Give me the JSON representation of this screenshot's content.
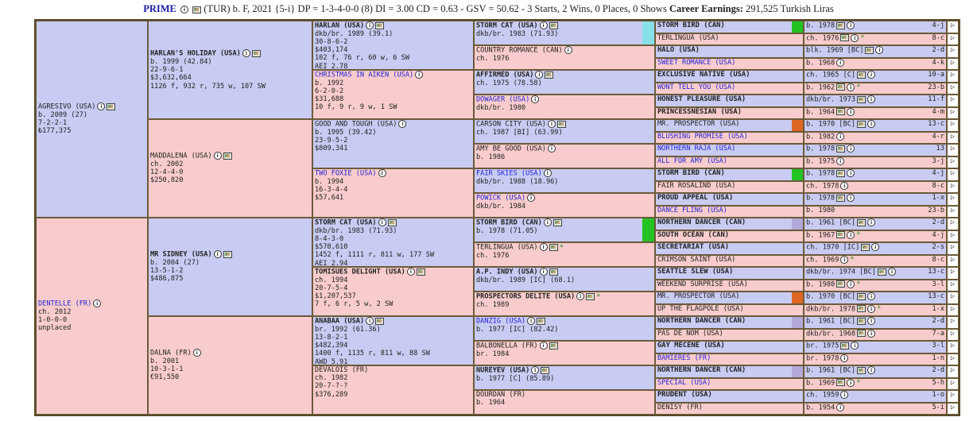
{
  "header": {
    "name": "PRIME",
    "desc1": "(TUR) b. F, 2021 {5-i} DP = 1-3-4-0-0 (8) DI = 3.00  CD = 0.63 - GSV = 50.62 - 3 Starts, 2 Wins, 0 Places, 0 Shows",
    "earnings_label": "Career Earnings:",
    "earnings_value": "291,525 Turkish Liras"
  },
  "colors": {
    "male": "#c8cbf2",
    "female": "#f8cccc",
    "border": "#5a4a2a",
    "link": "#2525d6",
    "green": "#22c322",
    "orange": "#dd6622",
    "cyan": "#88e0e8",
    "lavender": "#b3a8d8"
  },
  "g1": [
    {
      "name": "AGRESIVO (USA)",
      "lines": [
        "b. 2009 (27)",
        "7-2-2-1",
        "₺177,375"
      ],
      "icons": [
        "info",
        "photo"
      ],
      "sex": "m",
      "link": false
    },
    {
      "name": "DENTELLE (FR)",
      "lines": [
        "ch. 2012",
        "1-0-0-0",
        "unplaced"
      ],
      "icons": [
        "info"
      ],
      "sex": "f",
      "link": true
    }
  ],
  "g2": [
    {
      "name": "HARLAN'S HOLIDAY (USA)",
      "lines": [
        "b. 1999 (42.84)",
        "22-9-6-1",
        "$3,632,664",
        "1126 f, 932 r, 735 w, 107 SW"
      ],
      "icons": [
        "info",
        "photo"
      ],
      "sex": "m",
      "bold": true
    },
    {
      "name": "MADDALENA (USA)",
      "lines": [
        "ch. 2002",
        "12-4-4-0",
        "$250,820"
      ],
      "icons": [
        "info",
        "photo"
      ],
      "sex": "f"
    },
    {
      "name": "MR SIDNEY (USA)",
      "lines": [
        "b. 2004 (27)",
        "13-5-1-2",
        "$486,875"
      ],
      "icons": [
        "info",
        "photo"
      ],
      "sex": "m",
      "bold": true
    },
    {
      "name": "DALNA (FR)",
      "lines": [
        "b. 2001",
        "10-3-1-1",
        "€91,550"
      ],
      "icons": [
        "info"
      ],
      "sex": "f"
    }
  ],
  "g3": [
    {
      "name": "HARLAN (USA)",
      "lines": [
        "dkb/br. 1989 (39.1)",
        "30-8-6-2",
        "$403,174",
        "102 f, 76 r, 60 w, 6 SW",
        "AEI 2.78"
      ],
      "icons": [
        "info",
        "photo"
      ],
      "sex": "m",
      "bold": true
    },
    {
      "name": "CHRISTMAS IN AIKEN (USA)",
      "lines": [
        "b. 1992",
        "6-2-0-2",
        "$31,688",
        "10 f, 9 r, 9 w, 1 SW"
      ],
      "icons": [
        "info"
      ],
      "sex": "f",
      "link": true
    },
    {
      "name": "GOOD AND TOUGH (USA)",
      "lines": [
        "b. 1995 (39.42)",
        "23-9-5-2",
        "$809,341"
      ],
      "icons": [
        "info"
      ],
      "sex": "m"
    },
    {
      "name": "TWO FOXIE (USA)",
      "lines": [
        "b. 1994",
        "16-3-4-4",
        "$57,641"
      ],
      "icons": [
        "info"
      ],
      "sex": "f",
      "link": true
    },
    {
      "name": "STORM CAT (USA)",
      "lines": [
        "dkb/br. 1983 (71.93)",
        "8-4-3-0",
        "$570,610",
        "1452 f, 1111 r, 811 w, 177 SW",
        "AEI 2.94"
      ],
      "icons": [
        "info",
        "photo"
      ],
      "sex": "m",
      "bold": true
    },
    {
      "name": "TOMISUES DELIGHT (USA)",
      "lines": [
        "ch. 1994",
        "20-7-5-4",
        "$1,207,537",
        "7 f, 6 r, 5 w, 2 SW"
      ],
      "icons": [
        "info",
        "photo"
      ],
      "sex": "f",
      "bold": true
    },
    {
      "name": "ANABAA (USA)",
      "lines": [
        "br. 1992 (61.36)",
        "13-8-2-1",
        "$482,394",
        "1400 f, 1135 r, 811 w, 88 SW",
        "AWD 5.91"
      ],
      "icons": [
        "info",
        "photo"
      ],
      "sex": "m",
      "bold": true
    },
    {
      "name": "DEVALOIS (FR)",
      "lines": [
        "ch. 1982",
        "20-7-?-?",
        "$376,289"
      ],
      "icons": [],
      "sex": "f"
    }
  ],
  "g4": [
    {
      "name": "STORM CAT (USA)",
      "lines": [
        "dkb/br. 1983 (71.93)"
      ],
      "icons": [
        "info",
        "photo"
      ],
      "sex": "m",
      "bold": true,
      "bar": "cyan"
    },
    {
      "name": "COUNTRY ROMANCE (CAN)",
      "lines": [
        "ch. 1976"
      ],
      "icons": [
        "info"
      ],
      "sex": "f"
    },
    {
      "name": "AFFIRMED (USA)",
      "lines": [
        "ch. 1975 (78.58)"
      ],
      "icons": [
        "info",
        "photo"
      ],
      "sex": "m",
      "bold": true
    },
    {
      "name": "DOWAGER (USA)",
      "lines": [
        "dkb/br. 1980"
      ],
      "icons": [
        "info"
      ],
      "sex": "f",
      "link": true
    },
    {
      "name": "CARSON CITY (USA)",
      "lines": [
        "ch. 1987 [BI] (63.99)"
      ],
      "icons": [
        "info",
        "photo"
      ],
      "sex": "m"
    },
    {
      "name": "AMY BE GOOD (USA)",
      "lines": [
        "b. 1986"
      ],
      "icons": [
        "info"
      ],
      "sex": "f"
    },
    {
      "name": "FAIR SKIES (USA)",
      "lines": [
        "dkb/br. 1988 (18.96)"
      ],
      "icons": [
        "info"
      ],
      "sex": "m",
      "link": true
    },
    {
      "name": "POWICK (USA)",
      "lines": [
        "dkb/br. 1984"
      ],
      "icons": [
        "info"
      ],
      "sex": "f",
      "link": true
    },
    {
      "name": "STORM BIRD (CAN)",
      "lines": [
        "b. 1978 (71.05)"
      ],
      "icons": [
        "info",
        "photo"
      ],
      "sex": "m",
      "bold": true,
      "bar": "green"
    },
    {
      "name": "TERLINGUA (USA)",
      "lines": [
        "ch. 1976"
      ],
      "icons": [
        "info",
        "photo"
      ],
      "star": true,
      "sex": "f"
    },
    {
      "name": "A.P. INDY (USA)",
      "lines": [
        "dkb/br. 1989 [IC] (68.1)"
      ],
      "icons": [
        "info",
        "photo"
      ],
      "sex": "m",
      "bold": true
    },
    {
      "name": "PROSPECTORS DELITE (USA)",
      "lines": [
        "ch. 1989"
      ],
      "icons": [
        "info",
        "photo"
      ],
      "star": true,
      "sex": "f",
      "bold": true
    },
    {
      "name": "DANZIG (USA)",
      "lines": [
        "b. 1977 [IC] (82.42)"
      ],
      "icons": [
        "info",
        "photo"
      ],
      "sex": "m",
      "link": true
    },
    {
      "name": "BALBONELLA (FR)",
      "lines": [
        "br. 1984"
      ],
      "icons": [
        "info",
        "photo"
      ],
      "sex": "f"
    },
    {
      "name": "NUREYEV (USA)",
      "lines": [
        "b. 1977 [C] (85.89)"
      ],
      "icons": [
        "info",
        "photo"
      ],
      "sex": "m",
      "bold": true
    },
    {
      "name": "DOURDAN (FR)",
      "lines": [
        "b. 1964"
      ],
      "icons": [],
      "sex": "f"
    }
  ],
  "g5": [
    {
      "name": "STORM BIRD (CAN)",
      "sex": "m",
      "bold": true,
      "desc": "b. 1978",
      "icons": [
        "photo",
        "info"
      ],
      "dp": "4-j",
      "bar": "green"
    },
    {
      "name": "TERLINGUA (USA)",
      "sex": "f",
      "desc": "ch. 1976",
      "icons": [
        "photo",
        "info"
      ],
      "star": true,
      "dp": "8-c"
    },
    {
      "name": "HALO (USA)",
      "sex": "m",
      "bold": true,
      "desc": "blk. 1969 [BC]",
      "icons": [
        "photo",
        "info"
      ],
      "dp": "2-d",
      "big": true
    },
    {
      "name": "SWEET ROMANCE (USA)",
      "sex": "f",
      "link": true,
      "desc": "b. 1968",
      "icons": [
        "info"
      ],
      "dp": "4-k"
    },
    {
      "name": "EXCLUSIVE NATIVE (USA)",
      "sex": "m",
      "bold": true,
      "desc": "ch. 1965 [C]",
      "icons": [
        "photo",
        "info"
      ],
      "dp": "10-a"
    },
    {
      "name": "WONT TELL YOU (USA)",
      "sex": "f",
      "link": true,
      "desc": "b. 1962",
      "icons": [
        "photo",
        "info"
      ],
      "star": true,
      "dp": "23-b"
    },
    {
      "name": "HONEST PLEASURE (USA)",
      "sex": "m",
      "bold": true,
      "desc": "dkb/br. 1973",
      "icons": [
        "photo",
        "info"
      ],
      "dp": "11-f"
    },
    {
      "name": "PRINCESSNESIAN (USA)",
      "sex": "f",
      "bold": true,
      "desc": "b. 1964",
      "icons": [
        "photo",
        "info"
      ],
      "dp": "4-m"
    },
    {
      "name": "MR. PROSPECTOR (USA)",
      "sex": "m",
      "desc": "b. 1970 [BC]",
      "icons": [
        "photo",
        "info"
      ],
      "dp": "13-c",
      "bar": "orange"
    },
    {
      "name": "BLUSHING PROMISE (USA)",
      "sex": "f",
      "link": true,
      "desc": "b. 1982",
      "icons": [
        "info"
      ],
      "dp": "4-r"
    },
    {
      "name": "NORTHERN RAJA (USA)",
      "sex": "m",
      "link": true,
      "desc": "b. 1978",
      "icons": [
        "photo",
        "info"
      ],
      "dp": "13"
    },
    {
      "name": "ALL FOR AMY (USA)",
      "sex": "f",
      "link": true,
      "desc": "b. 1975",
      "icons": [
        "info"
      ],
      "dp": "3-j"
    },
    {
      "name": "STORM BIRD (CAN)",
      "sex": "m",
      "bold": true,
      "desc": "b. 1978",
      "icons": [
        "photo",
        "info"
      ],
      "dp": "4-j",
      "bar": "green"
    },
    {
      "name": "FAIR ROSALIND (USA)",
      "sex": "f",
      "desc": "ch. 1978",
      "icons": [
        "info"
      ],
      "dp": "8-c"
    },
    {
      "name": "PROUD APPEAL (USA)",
      "sex": "m",
      "bold": true,
      "desc": "b. 1978",
      "icons": [
        "photo",
        "info"
      ],
      "dp": "1-x"
    },
    {
      "name": "DANCE FLING (USA)",
      "sex": "f",
      "link": true,
      "desc": "b. 1980",
      "icons": [],
      "dp": "23-b"
    },
    {
      "name": "NORTHERN DANCER (CAN)",
      "sex": "m",
      "bold": true,
      "desc": "b. 1961 [BC]",
      "icons": [
        "photo",
        "info"
      ],
      "dp": "2-d",
      "bar": "lavender"
    },
    {
      "name": "SOUTH OCEAN (CAN)",
      "sex": "f",
      "bold": true,
      "desc": "b. 1967",
      "icons": [
        "photo",
        "info"
      ],
      "star": true,
      "dp": "4-j"
    },
    {
      "name": "SECRETARIAT (USA)",
      "sex": "m",
      "bold": true,
      "desc": "ch. 1970 [IC]",
      "icons": [
        "photo",
        "info"
      ],
      "dp": "2-s",
      "big": true
    },
    {
      "name": "CRIMSON SAINT (USA)",
      "sex": "f",
      "desc": "ch. 1969",
      "icons": [
        "info"
      ],
      "star": true,
      "dp": "8-c",
      "big": true
    },
    {
      "name": "SEATTLE SLEW (USA)",
      "sex": "m",
      "bold": true,
      "desc": "dkb/br. 1974 [BC]",
      "icons": [
        "photo",
        "info"
      ],
      "dp": "13-c"
    },
    {
      "name": "WEEKEND SURPRISE (USA)",
      "sex": "f",
      "desc": "b. 1980",
      "icons": [
        "photo",
        "info"
      ],
      "star": true,
      "dp": "3-l"
    },
    {
      "name": "MR. PROSPECTOR (USA)",
      "sex": "m",
      "desc": "b. 1970 [BC]",
      "icons": [
        "photo",
        "info"
      ],
      "dp": "13-c",
      "bar": "orange"
    },
    {
      "name": "UP THE FLAGPOLE (USA)",
      "sex": "f",
      "desc": "dkb/br. 1978",
      "icons": [
        "photo",
        "info"
      ],
      "star": true,
      "dp": "1-x"
    },
    {
      "name": "NORTHERN DANCER (CAN)",
      "sex": "m",
      "bold": true,
      "desc": "b. 1961 [BC]",
      "icons": [
        "photo",
        "info"
      ],
      "dp": "2-d",
      "bar": "lavender"
    },
    {
      "name": "PAS DE NOM (USA)",
      "sex": "f",
      "desc": "dkb/br. 1968",
      "icons": [
        "photo",
        "info"
      ],
      "dp": "7-a"
    },
    {
      "name": "GAY MECENE (USA)",
      "sex": "m",
      "bold": true,
      "desc": "br. 1975",
      "icons": [
        "photo",
        "info"
      ],
      "dp": "3-l",
      "big": true
    },
    {
      "name": "BAMIERES (FR)",
      "sex": "f",
      "link": true,
      "desc": "br. 1978",
      "icons": [
        "info"
      ],
      "dp": "1-n"
    },
    {
      "name": "NORTHERN DANCER (CAN)",
      "sex": "m",
      "bold": true,
      "desc": "b. 1961 [BC]",
      "icons": [
        "photo",
        "info"
      ],
      "dp": "2-d",
      "bar": "lavender"
    },
    {
      "name": "SPECIAL (USA)",
      "sex": "f",
      "link": true,
      "desc": "b. 1969",
      "icons": [
        "photo",
        "info"
      ],
      "star": true,
      "dp": "5-h"
    },
    {
      "name": "PRUDENT (USA)",
      "sex": "m",
      "bold": true,
      "desc": "ch. 1959",
      "icons": [
        "info"
      ],
      "dp": "1-o"
    },
    {
      "name": "DENISY (FR)",
      "sex": "f",
      "desc": "b. 1954",
      "icons": [
        "info"
      ],
      "dp": "5-i"
    }
  ]
}
